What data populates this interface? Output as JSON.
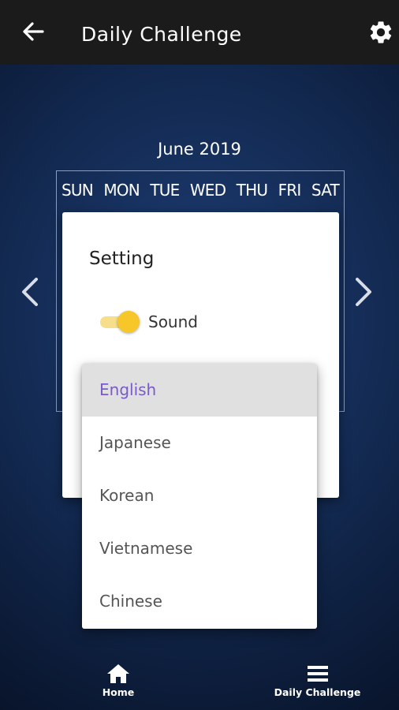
{
  "header": {
    "title": "Daily Challenge",
    "back_icon": "arrow-left-icon",
    "settings_icon": "gear-icon"
  },
  "calendar": {
    "month_label": "June 2019",
    "weekdays": [
      "SUN",
      "MON",
      "TUE",
      "WED",
      "THU",
      "FRI",
      "SAT"
    ],
    "prev_icon": "chevron-left-icon",
    "next_icon": "chevron-right-icon"
  },
  "dialog": {
    "title": "Setting",
    "sound": {
      "label": "Sound",
      "enabled": true
    }
  },
  "language_dropdown": {
    "selected": "English",
    "options": [
      "English",
      "Japanese",
      "Korean",
      "Vietnamese",
      "Chinese"
    ]
  },
  "bottom_nav": {
    "items": [
      {
        "label": "Home",
        "icon": "home-icon"
      },
      {
        "label": "Daily Challenge",
        "icon": "menu-icon"
      }
    ]
  },
  "colors": {
    "topbar": "#1b1b1b",
    "background": "#132a52",
    "toggle_on": "#f7c72a",
    "selected_text": "#7a59c9",
    "selected_bg": "#e0e0e0"
  }
}
